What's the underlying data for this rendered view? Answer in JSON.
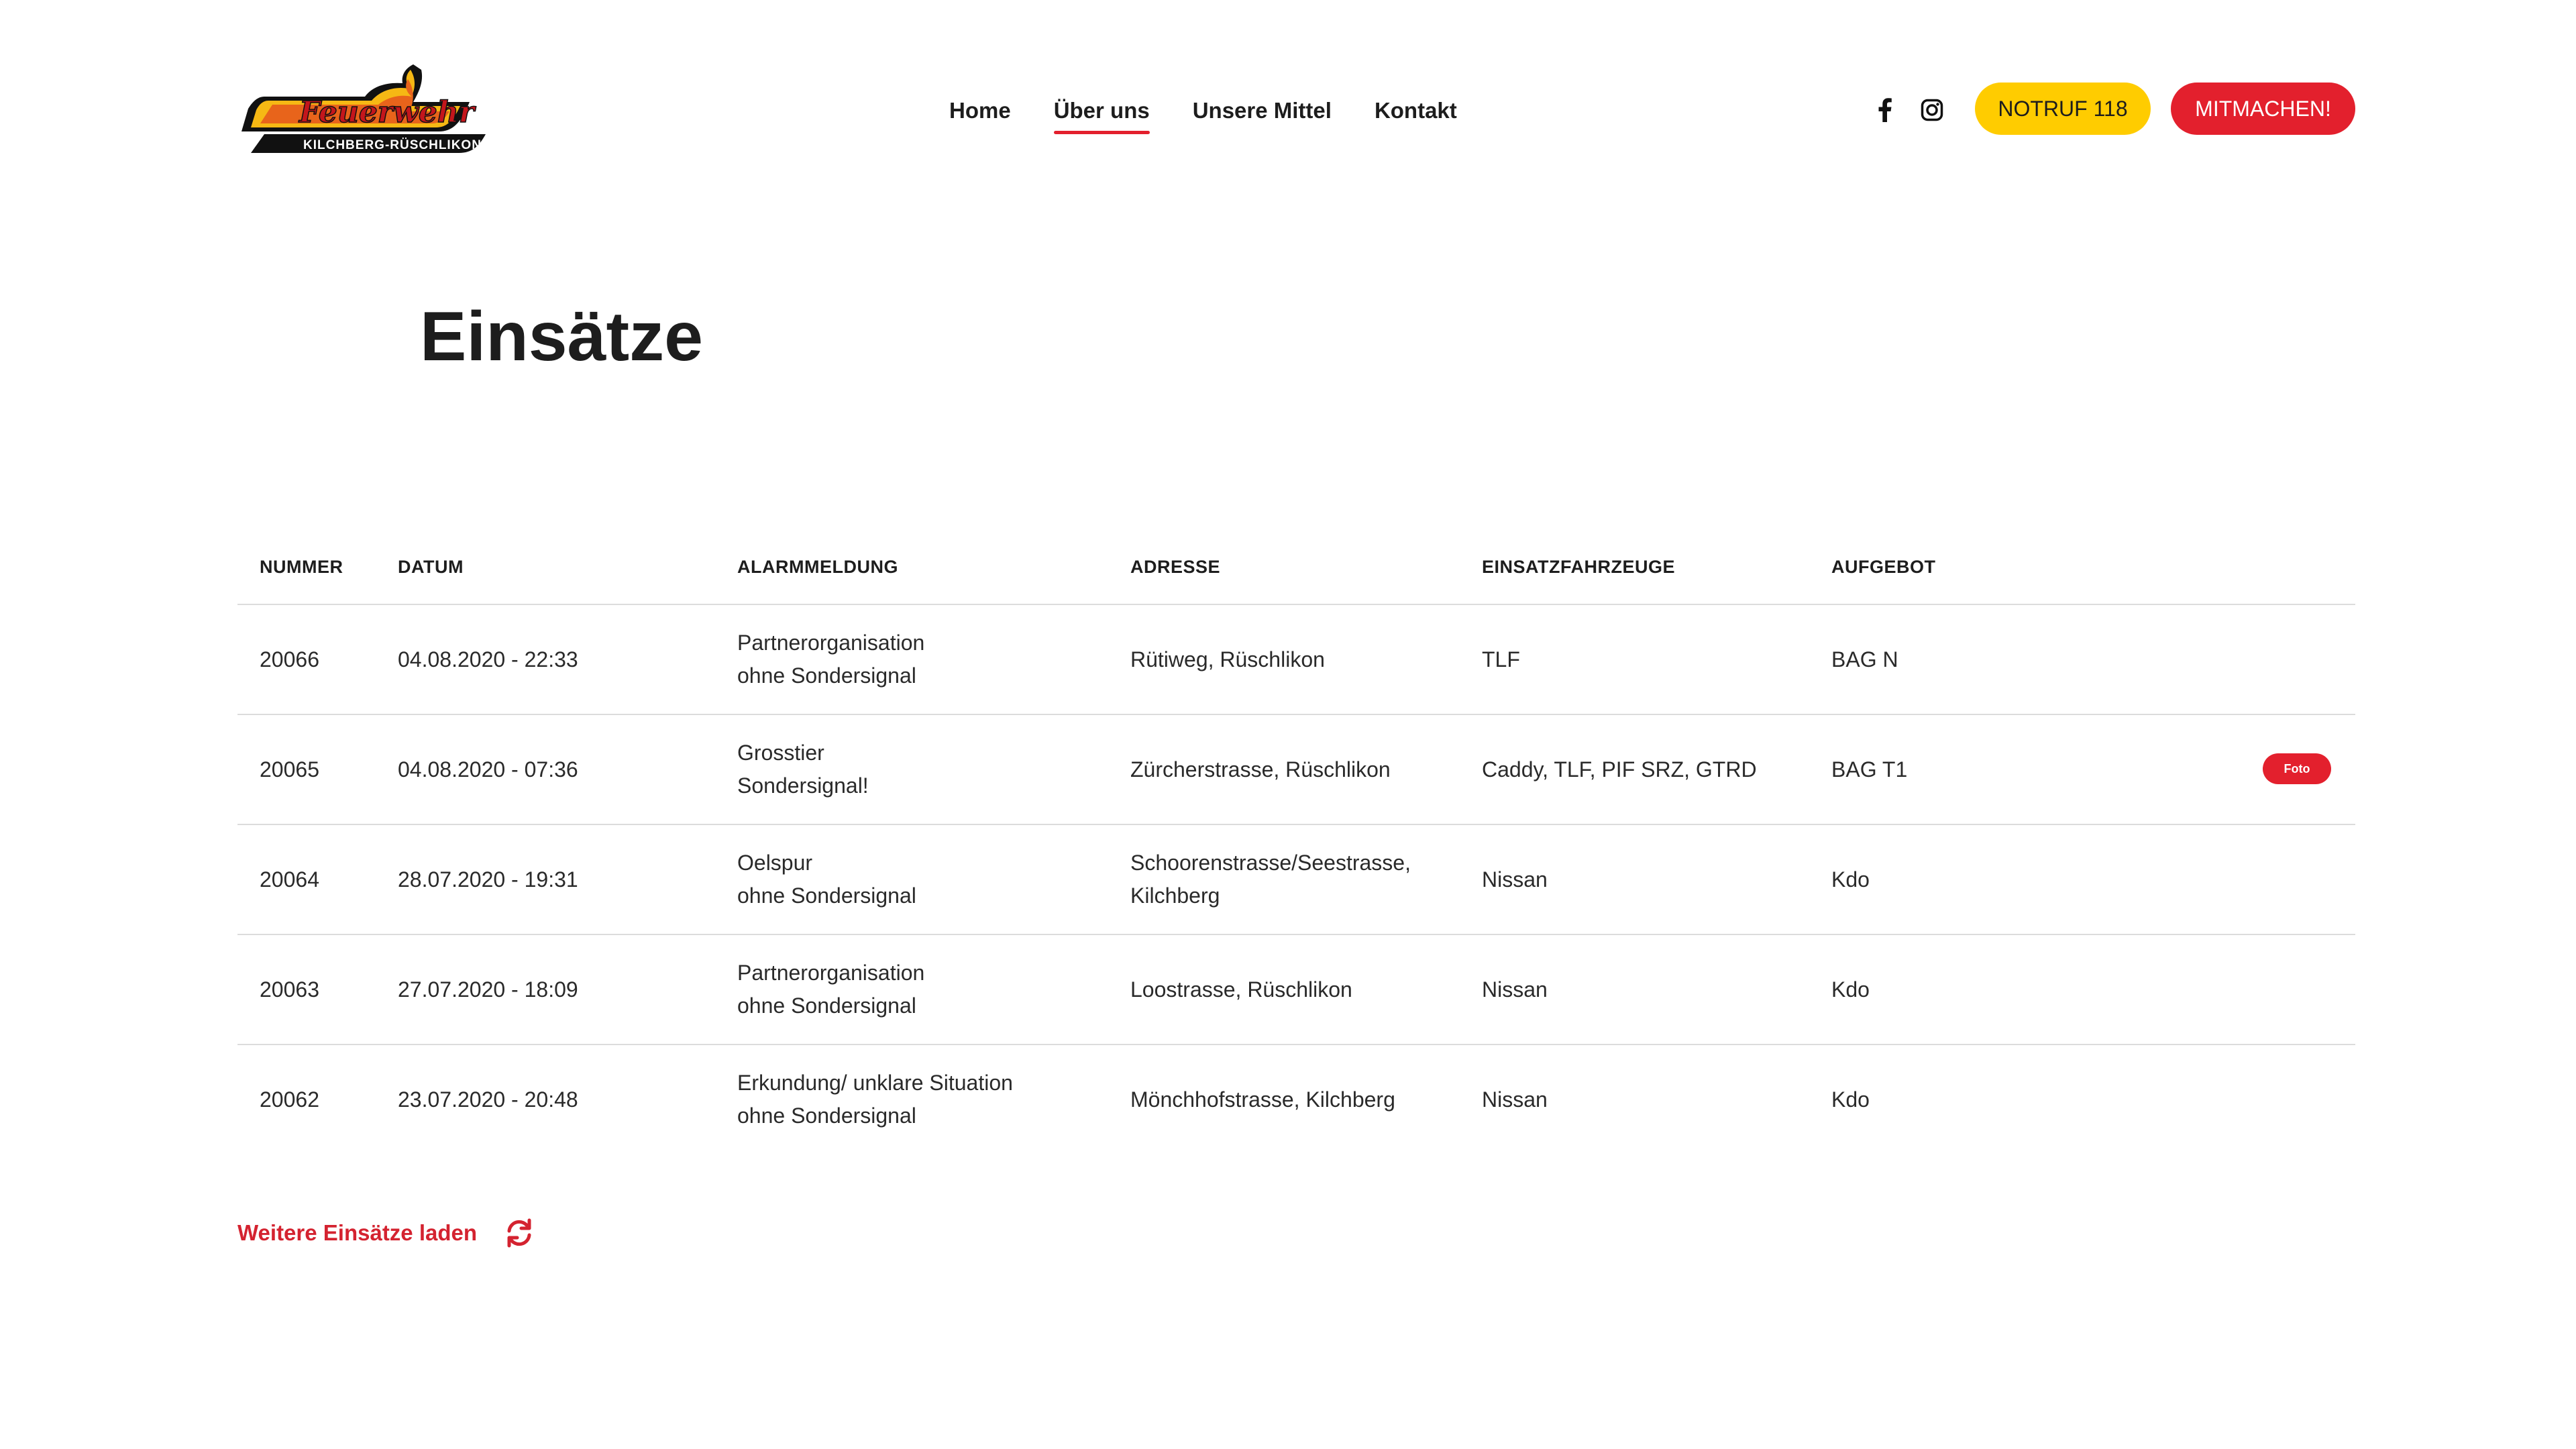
{
  "header": {
    "logo": {
      "wordmark": "Feuerwehr",
      "subline": "KILCHBERG-RÜSCHLIKON"
    },
    "nav": [
      {
        "label": "Home",
        "active": false
      },
      {
        "label": "Über uns",
        "active": true
      },
      {
        "label": "Unsere Mittel",
        "active": false
      },
      {
        "label": "Kontakt",
        "active": false
      }
    ],
    "social": [
      {
        "icon": "facebook-icon"
      },
      {
        "icon": "instagram-icon"
      }
    ],
    "notruf_label": "NOTRUF 118",
    "mitmachen_label": "MITMACHEN!"
  },
  "page": {
    "title": "Einsätze"
  },
  "table": {
    "columns": [
      "NUMMER",
      "DATUM",
      "ALARMMELDUNG",
      "ADRESSE",
      "EINSATZFAHRZEUGE",
      "AUFGEBOT"
    ],
    "rows": [
      {
        "nummer": "20066",
        "datum": "04.08.2020 - 22:33",
        "alarm": [
          "Partnerorganisation",
          "ohne Sondersignal"
        ],
        "adresse": [
          "Rütiweg, Rüschlikon"
        ],
        "fahrzeuge": "TLF",
        "aufgebot": "BAG N",
        "badge": ""
      },
      {
        "nummer": "20065",
        "datum": "04.08.2020 - 07:36",
        "alarm": [
          "Grosstier",
          "Sondersignal!"
        ],
        "adresse": [
          "Zürcherstrasse, Rüschlikon"
        ],
        "fahrzeuge": "Caddy, TLF, PIF SRZ, GTRD",
        "aufgebot": "BAG T1",
        "badge": "Foto"
      },
      {
        "nummer": "20064",
        "datum": "28.07.2020 - 19:31",
        "alarm": [
          "Oelspur",
          "ohne Sondersignal"
        ],
        "adresse": [
          "Schoorenstrasse/Seestrasse,",
          "Kilchberg"
        ],
        "fahrzeuge": "Nissan",
        "aufgebot": "Kdo",
        "badge": ""
      },
      {
        "nummer": "20063",
        "datum": "27.07.2020 - 18:09",
        "alarm": [
          "Partnerorganisation",
          "ohne Sondersignal"
        ],
        "adresse": [
          "Loostrasse, Rüschlikon"
        ],
        "fahrzeuge": "Nissan",
        "aufgebot": "Kdo",
        "badge": ""
      },
      {
        "nummer": "20062",
        "datum": "23.07.2020 - 20:48",
        "alarm": [
          "Erkundung/ unklare Situation",
          "ohne Sondersignal"
        ],
        "adresse": [
          "Mönchhofstrasse, Kilchberg"
        ],
        "fahrzeuge": "Nissan",
        "aufgebot": "Kdo",
        "badge": ""
      }
    ]
  },
  "load_more": {
    "label": "Weitere Einsätze laden",
    "icon": "refresh-icon"
  },
  "colors": {
    "accent_red": "#e3202d",
    "accent_yellow": "#ffcc00",
    "text_dark": "#1d1d1d",
    "divider": "#dcdcdc"
  }
}
